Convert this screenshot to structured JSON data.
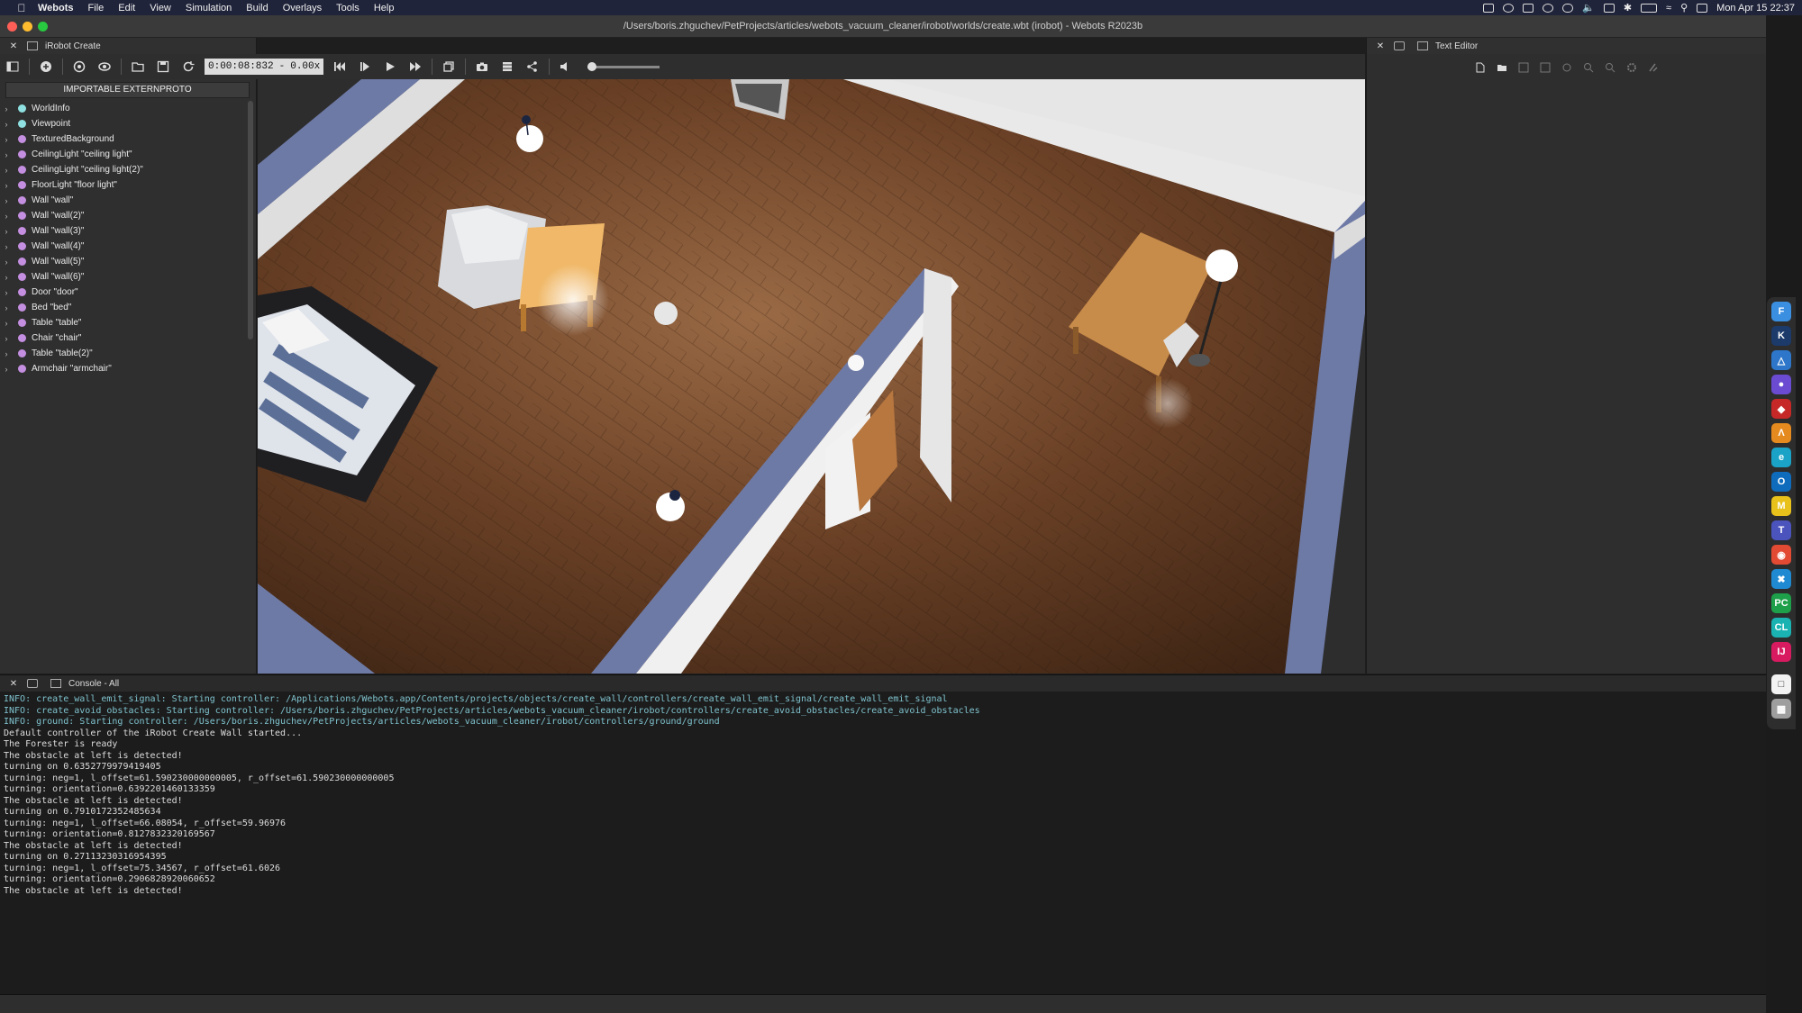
{
  "menubar": {
    "app": "Webots",
    "items": [
      "File",
      "Edit",
      "View",
      "Simulation",
      "Build",
      "Overlays",
      "Tools",
      "Help"
    ],
    "clock": "Mon Apr 15  22:37"
  },
  "window": {
    "title": "/Users/boris.zhguchev/PetProjects/articles/webots_vacuum_cleaner/irobot/worlds/create.wbt (irobot) - Webots R2023b"
  },
  "scene_panel": {
    "title": "iRobot Create",
    "importable_button": "IMPORTABLE EXTERNPROTO",
    "nodes": [
      {
        "label": "WorldInfo",
        "color": "#8fe0e0"
      },
      {
        "label": "Viewpoint",
        "color": "#8fe0e0"
      },
      {
        "label": "TexturedBackground",
        "color": "#c48fe0"
      },
      {
        "label": "CeilingLight \"ceiling light\"",
        "color": "#c48fe0"
      },
      {
        "label": "CeilingLight \"ceiling light(2)\"",
        "color": "#c48fe0"
      },
      {
        "label": "FloorLight \"floor light\"",
        "color": "#c48fe0"
      },
      {
        "label": "Wall \"wall\"",
        "color": "#c48fe0"
      },
      {
        "label": "Wall \"wall(2)\"",
        "color": "#c48fe0"
      },
      {
        "label": "Wall \"wall(3)\"",
        "color": "#c48fe0"
      },
      {
        "label": "Wall \"wall(4)\"",
        "color": "#c48fe0"
      },
      {
        "label": "Wall \"wall(5)\"",
        "color": "#c48fe0"
      },
      {
        "label": "Wall \"wall(6)\"",
        "color": "#c48fe0"
      },
      {
        "label": "Door \"door\"",
        "color": "#c48fe0"
      },
      {
        "label": "Bed \"bed\"",
        "color": "#c48fe0"
      },
      {
        "label": "Table \"table\"",
        "color": "#c48fe0"
      },
      {
        "label": "Chair \"chair\"",
        "color": "#c48fe0"
      },
      {
        "label": "Table \"table(2)\"",
        "color": "#c48fe0"
      },
      {
        "label": "Armchair \"armchair\"",
        "color": "#c48fe0"
      }
    ]
  },
  "toolbar": {
    "time": "0:00:08:832",
    "speed": "0.00x",
    "dash": "-"
  },
  "text_editor": {
    "title": "Text Editor"
  },
  "console": {
    "title": "Console - All",
    "lines": [
      {
        "type": "info",
        "text": "INFO: create_wall_emit_signal: Starting controller: /Applications/Webots.app/Contents/projects/objects/create_wall/controllers/create_wall_emit_signal/create_wall_emit_signal"
      },
      {
        "type": "info",
        "text": "INFO: create_avoid_obstacles: Starting controller: /Users/boris.zhguchev/PetProjects/articles/webots_vacuum_cleaner/irobot/controllers/create_avoid_obstacles/create_avoid_obstacles"
      },
      {
        "type": "info",
        "text": "INFO: ground: Starting controller: /Users/boris.zhguchev/PetProjects/articles/webots_vacuum_cleaner/irobot/controllers/ground/ground"
      },
      {
        "type": "plain",
        "text": "Default controller of the iRobot Create Wall started..."
      },
      {
        "type": "plain",
        "text": "The Forester is ready"
      },
      {
        "type": "plain",
        "text": "The obstacle at left is detected!"
      },
      {
        "type": "plain",
        "text": "turning on 0.6352779979419405"
      },
      {
        "type": "plain",
        "text": "turning: neg=1, l_offset=61.590230000000005, r_offset=61.590230000000005"
      },
      {
        "type": "plain",
        "text": "turning: orientation=0.6392201460133359"
      },
      {
        "type": "plain",
        "text": "The obstacle at left is detected!"
      },
      {
        "type": "plain",
        "text": "turning on 0.7910172352485634"
      },
      {
        "type": "plain",
        "text": "turning: neg=1, l_offset=66.08054, r_offset=59.96976"
      },
      {
        "type": "plain",
        "text": "turning: orientation=0.8127832320169567"
      },
      {
        "type": "plain",
        "text": "The obstacle at left is detected!"
      },
      {
        "type": "plain",
        "text": "turning on 0.27113230316954395"
      },
      {
        "type": "plain",
        "text": "turning: neg=1, l_offset=75.34567, r_offset=61.6026"
      },
      {
        "type": "plain",
        "text": "turning: orientation=0.2906828920060652"
      },
      {
        "type": "plain",
        "text": "The obstacle at left is detected!"
      }
    ]
  }
}
